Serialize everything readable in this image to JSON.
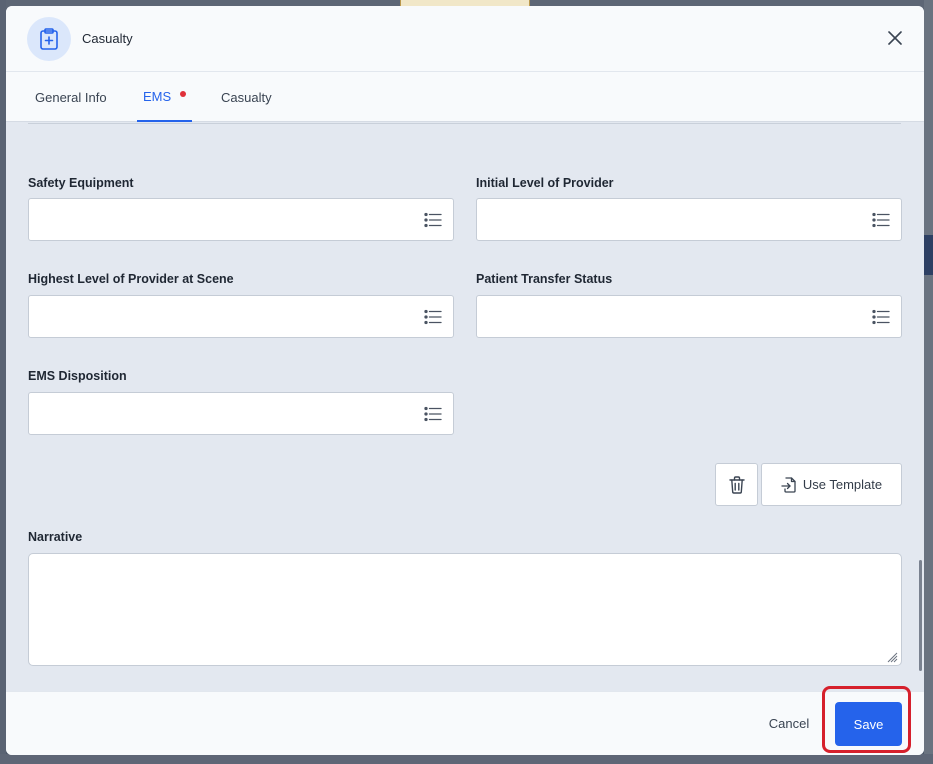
{
  "modal": {
    "title": "Casualty",
    "header_icon": "clipboard-medical-icon",
    "close_icon": "close-icon"
  },
  "tabs": [
    {
      "label": "General Info",
      "active": false
    },
    {
      "label": "EMS",
      "active": true,
      "has_indicator": true
    },
    {
      "label": "Casualty",
      "active": false
    }
  ],
  "fields": {
    "safety_equipment": {
      "label": "Safety Equipment",
      "value": ""
    },
    "initial_level_provider": {
      "label": "Initial Level of Provider",
      "value": ""
    },
    "highest_level_provider": {
      "label": "Highest Level of Provider at Scene",
      "value": ""
    },
    "patient_transfer_status": {
      "label": "Patient Transfer Status",
      "value": ""
    },
    "ems_disposition": {
      "label": "EMS Disposition",
      "value": ""
    }
  },
  "narrative": {
    "label": "Narrative",
    "value": ""
  },
  "actions": {
    "delete_icon": "trash-icon",
    "use_template_label": "Use Template",
    "template_icon": "file-import-icon"
  },
  "footer": {
    "cancel_label": "Cancel",
    "save_label": "Save"
  },
  "colors": {
    "accent": "#2563eb",
    "indicator": "#e0303a",
    "highlight": "#d6202c"
  }
}
